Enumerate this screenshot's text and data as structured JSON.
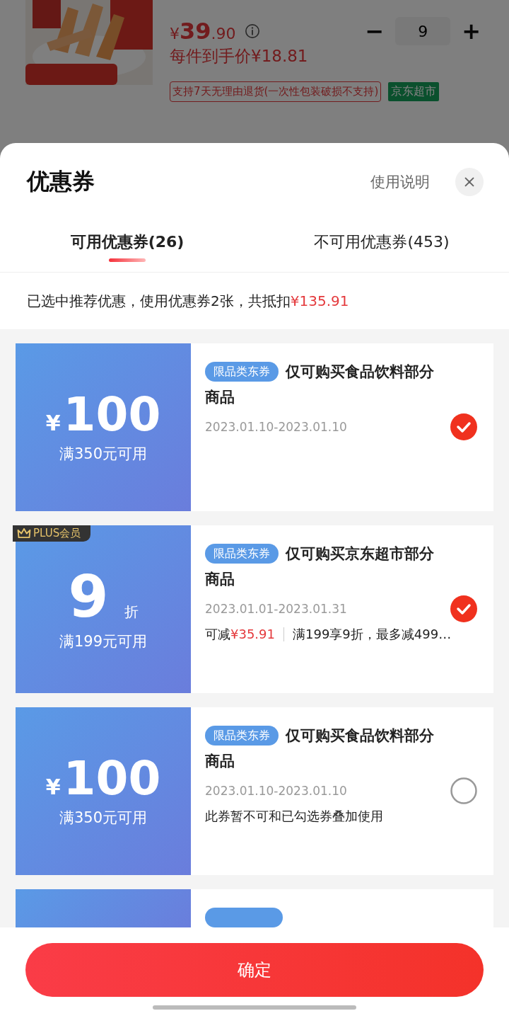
{
  "product": {
    "price_symbol": "¥",
    "price_main": "39",
    "price_decimal": ".90",
    "quantity": "9",
    "minus": "−",
    "plus": "+",
    "net_price": "每件到手价¥18.81",
    "return_policy": "支持7天无理由退货(一次性包装破损不支持)",
    "store_tag": "京东超市"
  },
  "sheet": {
    "title": "优惠券",
    "help_link": "使用说明",
    "tabs": [
      {
        "label": "可用优惠券(26)",
        "selected": true
      },
      {
        "label": "不可用优惠券(453)",
        "selected": false
      }
    ],
    "summary": {
      "text": "已选中推荐优惠，使用优惠券2张，共抵扣",
      "amount": "¥135.91"
    },
    "coupons": [
      {
        "kind": "amount",
        "symbol": "¥",
        "value": "100",
        "condition": "满350元可用",
        "tag": "限品类东券",
        "title": "仅可购买食品饮料部分商品",
        "date": "2023.01.10-2023.01.10",
        "selected": true
      },
      {
        "kind": "discount",
        "badge": "PLUS会员",
        "value": "9",
        "unit": "折",
        "condition": "满199元可用",
        "tag": "限品类东券",
        "title": "仅可购买京东超市部分商品",
        "date": "2023.01.01-2023.01.31",
        "note": {
          "prefix": "可减",
          "amount": "¥35.91",
          "detail": "满199享9折，最多减499…"
        },
        "selected": true
      },
      {
        "kind": "amount",
        "symbol": "¥",
        "value": "100",
        "condition": "满350元可用",
        "tag": "限品类东券",
        "title": "仅可购买食品饮料部分商品",
        "date": "2023.01.10-2023.01.10",
        "note": {
          "detail": "此券暂不可和已勾选券叠加使用"
        },
        "selected": false
      },
      {
        "kind": "partial"
      }
    ],
    "confirm_button": "确定"
  }
}
